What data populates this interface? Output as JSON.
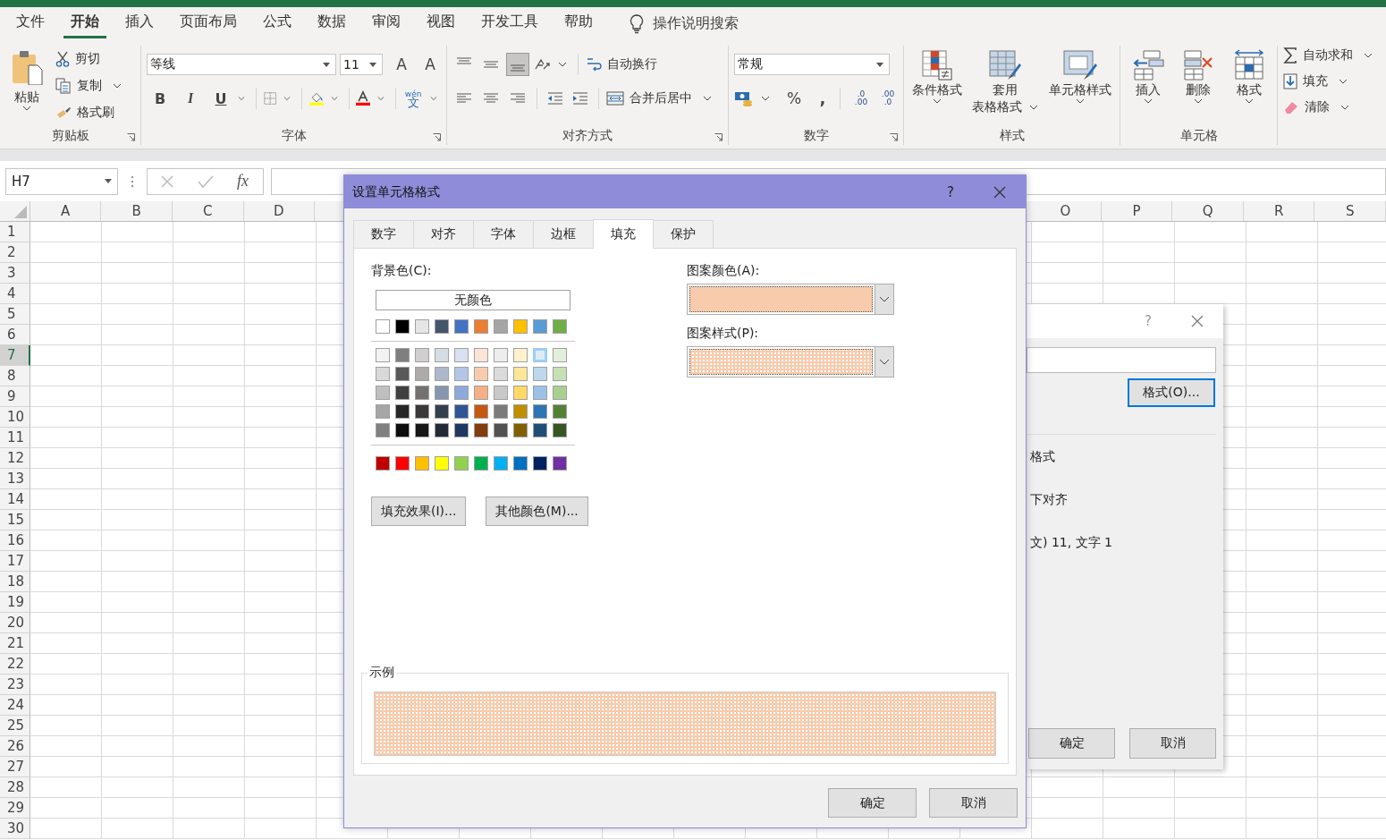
{
  "app_tabs": [
    {
      "label": "文件",
      "selected": false
    },
    {
      "label": "开始",
      "selected": true
    },
    {
      "label": "插入",
      "selected": false
    },
    {
      "label": "页面布局",
      "selected": false
    },
    {
      "label": "公式",
      "selected": false
    },
    {
      "label": "数据",
      "selected": false
    },
    {
      "label": "审阅",
      "selected": false
    },
    {
      "label": "视图",
      "selected": false
    },
    {
      "label": "开发工具",
      "selected": false
    },
    {
      "label": "帮助",
      "selected": false
    }
  ],
  "tell_me": "操作说明搜索",
  "ribbon": {
    "clipboard": {
      "paste": "粘贴",
      "cut": "剪切",
      "copy": "复制",
      "format_painter": "格式刷",
      "label": "剪贴板"
    },
    "font": {
      "name": "等线",
      "size": "11",
      "grow": "A",
      "shrink": "A",
      "bold": "B",
      "italic": "I",
      "underline": "U",
      "phonetic_top": "wén",
      "phonetic": "文",
      "label": "字体"
    },
    "alignment": {
      "wrap": "自动换行",
      "merge": "合并后居中",
      "label": "对齐方式"
    },
    "number": {
      "format": "常规",
      "percent": "%",
      "comma": ",",
      "inc_top": ".0",
      "inc_bottom": ".00",
      "dec_top": ".00",
      "dec_bottom": ".0",
      "label": "数字"
    },
    "styles": {
      "conditional": "条件格式",
      "table_1": "套用",
      "table_2": "表格格式",
      "cell_styles": "单元格样式",
      "label": "样式"
    },
    "cells": {
      "insert": "插入",
      "delete": "删除",
      "format": "格式",
      "label": "单元格"
    },
    "editing": {
      "autosum": "自动求和",
      "fill": "填充",
      "clear": "清除"
    }
  },
  "formula_bar": {
    "name_box": "H7",
    "fx": "fx"
  },
  "columns": {
    "left": [
      "A",
      "B",
      "C",
      "D"
    ],
    "right": [
      "O",
      "P",
      "Q",
      "R",
      "S"
    ]
  },
  "rows": [
    {
      "label": "1",
      "selected": false
    },
    {
      "label": "2",
      "selected": false
    },
    {
      "label": "3",
      "selected": false
    },
    {
      "label": "4",
      "selected": false
    },
    {
      "label": "5",
      "selected": false
    },
    {
      "label": "6",
      "selected": false
    },
    {
      "label": "7",
      "selected": true
    },
    {
      "label": "8",
      "selected": false
    },
    {
      "label": "9",
      "selected": false
    },
    {
      "label": "10",
      "selected": false
    },
    {
      "label": "11",
      "selected": false
    },
    {
      "label": "12",
      "selected": false
    },
    {
      "label": "13",
      "selected": false
    },
    {
      "label": "14",
      "selected": false
    },
    {
      "label": "15",
      "selected": false
    },
    {
      "label": "16",
      "selected": false
    },
    {
      "label": "17",
      "selected": false
    },
    {
      "label": "18",
      "selected": false
    },
    {
      "label": "19",
      "selected": false
    },
    {
      "label": "20",
      "selected": false
    },
    {
      "label": "21",
      "selected": false
    },
    {
      "label": "22",
      "selected": false
    },
    {
      "label": "23",
      "selected": false
    },
    {
      "label": "24",
      "selected": false
    },
    {
      "label": "25",
      "selected": false
    },
    {
      "label": "26",
      "selected": false
    },
    {
      "label": "27",
      "selected": false
    },
    {
      "label": "28",
      "selected": false
    },
    {
      "label": "29",
      "selected": false
    },
    {
      "label": "30",
      "selected": false
    }
  ],
  "back_dialog": {
    "help": "?",
    "format_button": "格式(O)...",
    "line_1": "格式",
    "line_2": "下对齐",
    "line_3": "文) 11, 文字 1",
    "ok": "确定",
    "cancel": "取消"
  },
  "dialog": {
    "title": "设置单元格格式",
    "help": "?",
    "tabs": [
      {
        "label": "数字",
        "selected": false
      },
      {
        "label": "对齐",
        "selected": false
      },
      {
        "label": "字体",
        "selected": false
      },
      {
        "label": "边框",
        "selected": false
      },
      {
        "label": "填充",
        "selected": true
      },
      {
        "label": "保护",
        "selected": false
      }
    ],
    "background_label": "背景色(C):",
    "no_color": "无颜色",
    "theme_colors": [
      {
        "color": "#ffffff",
        "selected": false
      },
      {
        "color": "#000000",
        "selected": false
      },
      {
        "color": "#e7e6e6",
        "selected": false
      },
      {
        "color": "#44546a",
        "selected": false
      },
      {
        "color": "#4472c4",
        "selected": false
      },
      {
        "color": "#ed7d31",
        "selected": false
      },
      {
        "color": "#a5a5a5",
        "selected": false
      },
      {
        "color": "#ffc000",
        "selected": false
      },
      {
        "color": "#5b9bd5",
        "selected": false
      },
      {
        "color": "#70ad47",
        "selected": false
      }
    ],
    "tint_rows": [
      [
        {
          "color": "#f2f2f2",
          "selected": false
        },
        {
          "color": "#7f7f7f",
          "selected": false
        },
        {
          "color": "#d0cece",
          "selected": false
        },
        {
          "color": "#d6dce4",
          "selected": false
        },
        {
          "color": "#d9e1f2",
          "selected": false
        },
        {
          "color": "#fce4d6",
          "selected": false
        },
        {
          "color": "#ededed",
          "selected": false
        },
        {
          "color": "#fff2cc",
          "selected": false
        },
        {
          "color": "#ddebf7",
          "selected": true
        },
        {
          "color": "#e2efda",
          "selected": false
        }
      ],
      [
        {
          "color": "#d9d9d9",
          "selected": false
        },
        {
          "color": "#595959",
          "selected": false
        },
        {
          "color": "#aeaaaa",
          "selected": false
        },
        {
          "color": "#adb9ca",
          "selected": false
        },
        {
          "color": "#b4c6e7",
          "selected": false
        },
        {
          "color": "#f8cbad",
          "selected": false
        },
        {
          "color": "#dbdbdb",
          "selected": false
        },
        {
          "color": "#ffe699",
          "selected": false
        },
        {
          "color": "#bdd7ee",
          "selected": false
        },
        {
          "color": "#c6e0b4",
          "selected": false
        }
      ],
      [
        {
          "color": "#bfbfbf",
          "selected": false
        },
        {
          "color": "#404040",
          "selected": false
        },
        {
          "color": "#757171",
          "selected": false
        },
        {
          "color": "#8497b0",
          "selected": false
        },
        {
          "color": "#8ea9db",
          "selected": false
        },
        {
          "color": "#f4b084",
          "selected": false
        },
        {
          "color": "#c9c9c9",
          "selected": false
        },
        {
          "color": "#ffd966",
          "selected": false
        },
        {
          "color": "#9bc2e6",
          "selected": false
        },
        {
          "color": "#a9d08e",
          "selected": false
        }
      ],
      [
        {
          "color": "#a6a6a6",
          "selected": false
        },
        {
          "color": "#262626",
          "selected": false
        },
        {
          "color": "#3a3838",
          "selected": false
        },
        {
          "color": "#333f4f",
          "selected": false
        },
        {
          "color": "#305496",
          "selected": false
        },
        {
          "color": "#c65911",
          "selected": false
        },
        {
          "color": "#7b7b7b",
          "selected": false
        },
        {
          "color": "#bf8f00",
          "selected": false
        },
        {
          "color": "#2f75b5",
          "selected": false
        },
        {
          "color": "#548235",
          "selected": false
        }
      ],
      [
        {
          "color": "#808080",
          "selected": false
        },
        {
          "color": "#0d0d0d",
          "selected": false
        },
        {
          "color": "#161616",
          "selected": false
        },
        {
          "color": "#222b35",
          "selected": false
        },
        {
          "color": "#203764",
          "selected": false
        },
        {
          "color": "#833c0c",
          "selected": false
        },
        {
          "color": "#525252",
          "selected": false
        },
        {
          "color": "#806000",
          "selected": false
        },
        {
          "color": "#1f4e78",
          "selected": false
        },
        {
          "color": "#375623",
          "selected": false
        }
      ]
    ],
    "standard_colors": [
      {
        "color": "#c00000",
        "selected": false
      },
      {
        "color": "#ff0000",
        "selected": false
      },
      {
        "color": "#ffc000",
        "selected": false
      },
      {
        "color": "#ffff00",
        "selected": false
      },
      {
        "color": "#92d050",
        "selected": false
      },
      {
        "color": "#00b050",
        "selected": false
      },
      {
        "color": "#00b0f0",
        "selected": false
      },
      {
        "color": "#0070c0",
        "selected": false
      },
      {
        "color": "#002060",
        "selected": false
      },
      {
        "color": "#7030a0",
        "selected": false
      }
    ],
    "fill_effects": "填充效果(I)...",
    "more_colors": "其他颜色(M)...",
    "pattern_color_label": "图案颜色(A):",
    "pattern_color": {
      "color": "#f8cbad"
    },
    "pattern_style_label": "图案样式(P):",
    "sample_label": "示例",
    "ok": "确定",
    "cancel": "取消"
  }
}
